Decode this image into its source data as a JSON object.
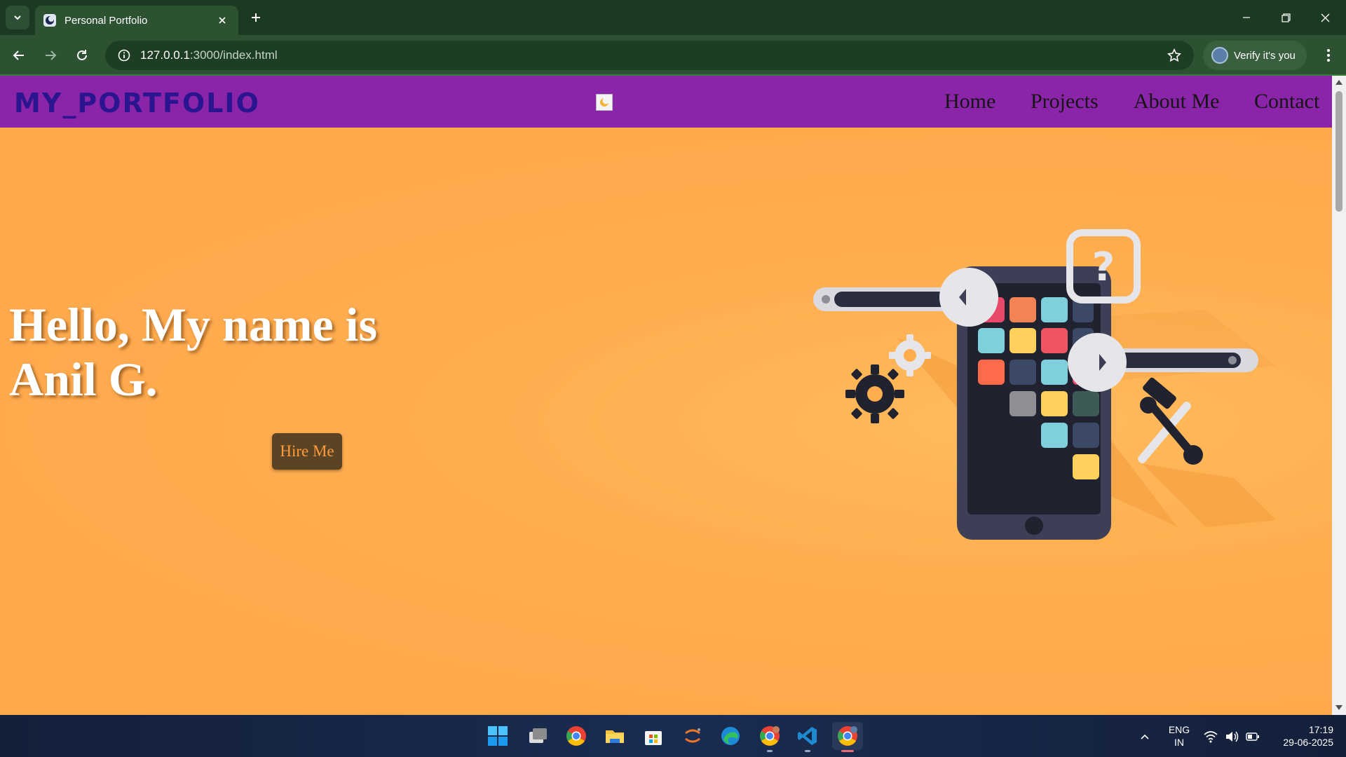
{
  "browser": {
    "tab_title": "Personal Portfolio",
    "url_host": "127.0.0.1",
    "url_path": ":3000/index.html",
    "profile_label": "Verify it's you"
  },
  "site": {
    "logo": "MY_PORTFOLIO",
    "nav": [
      "Home",
      "Projects",
      "About Me",
      "Contact"
    ],
    "theme_icon": "moon-icon",
    "hero_heading": "Hello, My name is Anil G.",
    "hire_label": "Hire Me",
    "illustration": "mobile-app-development-icon",
    "colors": {
      "nav_bg": "#8a24a8",
      "logo": "#2b148f",
      "hero_bg": "#ffa94d",
      "button_bg": "#5a4424",
      "button_text": "#ff9a3d"
    }
  },
  "taskbar": {
    "apps": [
      "windows-start-icon",
      "task-view-icon",
      "chrome-icon",
      "file-explorer-icon",
      "microsoft-store-icon",
      "jupyter-icon",
      "edge-icon",
      "chrome-profile-icon",
      "vscode-icon",
      "chrome-active-icon"
    ],
    "language": "ENG",
    "region": "IN",
    "time": "17:19",
    "date": "29-06-2025"
  }
}
